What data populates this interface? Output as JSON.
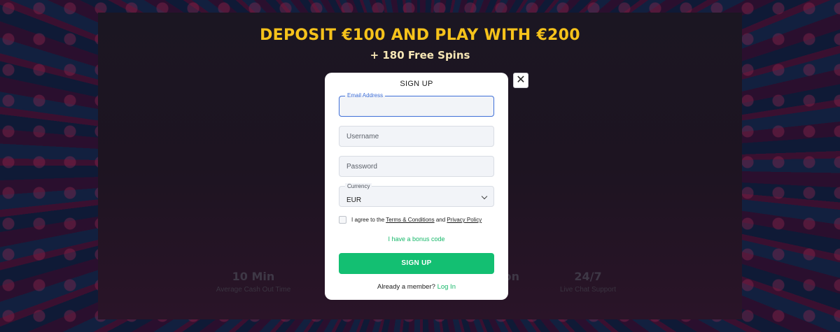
{
  "promo": {
    "headline": "DEPOSIT €100 AND PLAY WITH €200",
    "subline": "+ 180 Free Spins"
  },
  "stats": [
    {
      "value": "10 Min",
      "label": "Average Cash Out Time"
    },
    {
      "value": "on",
      "label": "s"
    },
    {
      "value": "24/7",
      "label": "Live Chat Support"
    }
  ],
  "modal": {
    "title": "SIGN UP",
    "close_icon": "close-icon",
    "email": {
      "label": "Email Address",
      "value": ""
    },
    "username": {
      "placeholder": "Username"
    },
    "password": {
      "placeholder": "Password"
    },
    "currency": {
      "label": "Currency",
      "value": "EUR"
    },
    "agree": {
      "prefix": "I agree to the",
      "terms": "Terms & Conditions",
      "and": "and",
      "privacy": "Privacy Policy"
    },
    "bonus_link": "I have a bonus code",
    "submit": "SIGN UP",
    "member_text": "Already a member?",
    "login_link": "Log In"
  },
  "colors": {
    "accent_green": "#13bf72",
    "headline_yellow": "#f5c21b",
    "focus_blue": "#3f6fd8"
  }
}
